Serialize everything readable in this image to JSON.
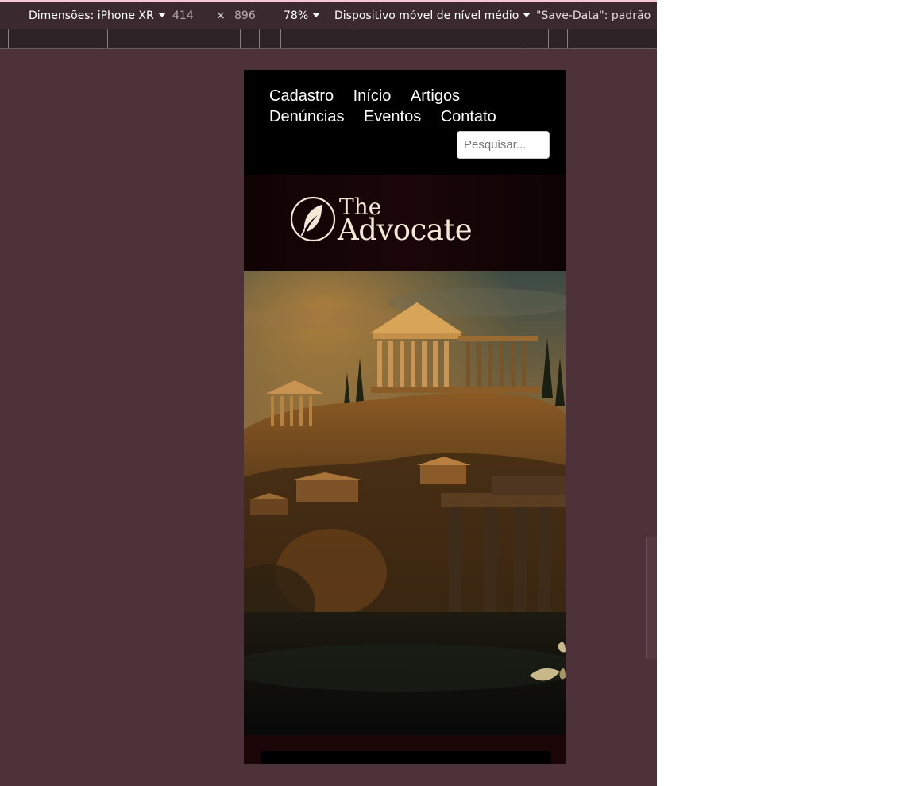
{
  "devtools": {
    "device_label": "Dimensões: iPhone XR",
    "width_value": "414",
    "times_sign": "×",
    "height_value": "896",
    "zoom": "78%",
    "throttling": "Dispositivo móvel de nível médio",
    "save_data": "\"Save-Data\": padrão"
  },
  "site": {
    "nav": {
      "row1": [
        "Cadastro",
        "Início",
        "Artigos"
      ],
      "row2": [
        "Denúncias",
        "Eventos",
        "Contato"
      ]
    },
    "search": {
      "placeholder": "Pesquisar..."
    },
    "logo": {
      "line1": "The",
      "line2": "Advocate",
      "icon": "quill-feather-icon"
    },
    "hero": {
      "icon": "ancient-greek-temple-illustration"
    }
  },
  "colors": {
    "devtools_bg": "#4e3239",
    "toolbar_bg": "#3a2a2f",
    "site_bg": "#000000",
    "brand_bar_bg": "#1a0608",
    "logo_cream": "#f3e9d6"
  }
}
